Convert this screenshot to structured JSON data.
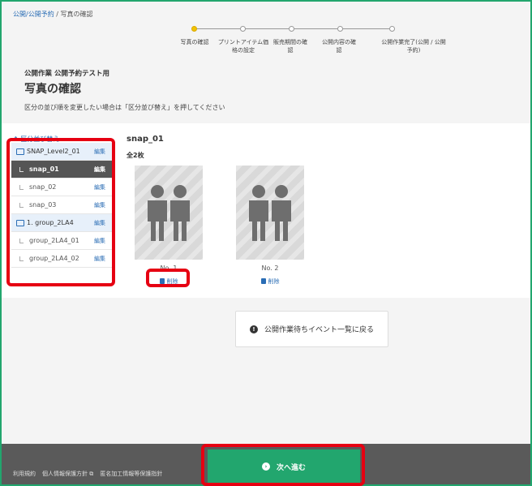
{
  "breadcrumb": {
    "link": "公開/公開予約",
    "separator": "/",
    "current": "写真の確認"
  },
  "steps": [
    {
      "label": "写真の確認",
      "active": true
    },
    {
      "label": "プリントアイテム価格の設定",
      "active": false
    },
    {
      "label": "販売期間の確認",
      "active": false
    },
    {
      "label": "公開内容の確認",
      "active": false
    },
    {
      "label": "公開作業完了(公開 / 公開予約)",
      "active": false
    }
  ],
  "header": {
    "event_title": "公開作業 公開予約テスト用",
    "page_title": "写真の確認",
    "instruction": "区分の並び順を変更したい場合は「区分並び替え」を押してください"
  },
  "sidebar": {
    "sort_link": "↑ 区分並び替え",
    "items": [
      {
        "label": "SNAP_Level2_01",
        "edit": "編集",
        "type": "group"
      },
      {
        "label": "snap_01",
        "edit": "編集",
        "type": "selected"
      },
      {
        "label": "snap_02",
        "edit": "編集",
        "type": "child"
      },
      {
        "label": "snap_03",
        "edit": "編集",
        "type": "child"
      },
      {
        "label": "1. group_2LA4",
        "edit": "編集",
        "type": "group"
      },
      {
        "label": "group_2LA4_01",
        "edit": "編集",
        "type": "child"
      },
      {
        "label": "group_2LA4_02",
        "edit": "編集",
        "type": "child"
      }
    ]
  },
  "main": {
    "snap_title": "snap_01",
    "count": "全2枚",
    "photos": [
      {
        "number": "No. 1",
        "delete": "削除"
      },
      {
        "number": "No. 2",
        "delete": "削除"
      }
    ],
    "back_button": "公開作業待ちイベント一覧に戻る",
    "back_icon": "!"
  },
  "footer": {
    "links": [
      "利用規約",
      "個人情報保護方針",
      "匿名加工情報等保護指針"
    ],
    "external_icon": "⧉",
    "next_button": "次へ進む",
    "next_icon": "›"
  },
  "colors": {
    "accent": "#22a66e",
    "highlight": "#e60012",
    "link": "#2a6db5",
    "step_active": "#f2c300"
  }
}
